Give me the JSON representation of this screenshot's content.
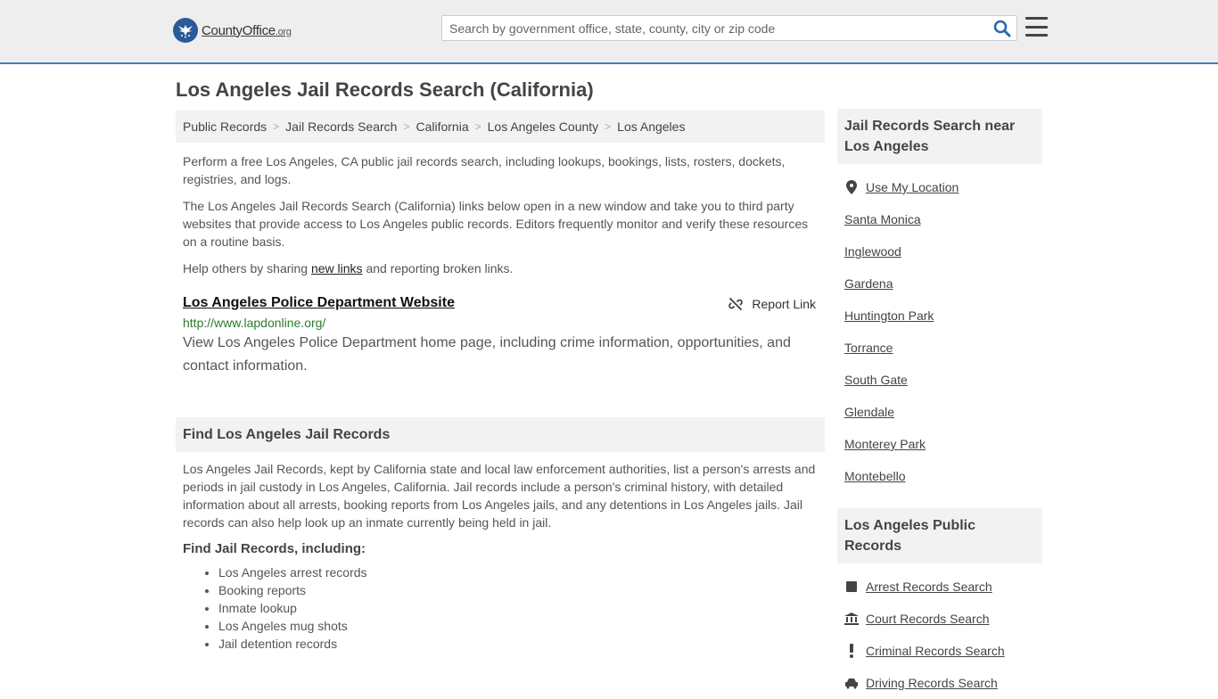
{
  "header": {
    "logo_text": "CountyOffice",
    "logo_tld": ".org",
    "search_placeholder": "Search by government office, state, county, city or zip code"
  },
  "page_title": "Los Angeles Jail Records Search (California)",
  "breadcrumb": [
    "Public Records",
    "Jail Records Search",
    "California",
    "Los Angeles County",
    "Los Angeles"
  ],
  "intro": {
    "p1": "Perform a free Los Angeles, CA public jail records search, including lookups, bookings, lists, rosters, dockets, registries, and logs.",
    "p2": "The Los Angeles Jail Records Search (California) links below open in a new window and take you to third party websites that provide access to Los Angeles public records. Editors frequently monitor and verify these resources on a routine basis.",
    "p3_pre": "Help others by sharing ",
    "p3_link": "new links",
    "p3_post": " and reporting broken links."
  },
  "result": {
    "title": "Los Angeles Police Department Website",
    "report_label": "Report Link",
    "url": "http://www.lapdonline.org/",
    "description": "View Los Angeles Police Department home page, including crime information, opportunities, and contact information."
  },
  "find_section": {
    "heading": "Find Los Angeles Jail Records",
    "body": "Los Angeles Jail Records, kept by California state and local law enforcement authorities, list a person's arrests and periods in jail custody in Los Angeles, California. Jail records include a person's criminal history, with detailed information about all arrests, booking reports from Los Angeles jails, and any detentions in Los Angeles jails. Jail records can also help look up an inmate currently being held in jail.",
    "subheading": "Find Jail Records, including:",
    "items": [
      "Los Angeles arrest records",
      "Booking reports",
      "Inmate lookup",
      "Los Angeles mug shots",
      "Jail detention records"
    ]
  },
  "sidebar": {
    "nearby_heading": "Jail Records Search near Los Angeles",
    "use_location": "Use My Location",
    "nearby": [
      "Santa Monica",
      "Inglewood",
      "Gardena",
      "Huntington Park",
      "Torrance",
      "South Gate",
      "Glendale",
      "Monterey Park",
      "Montebello"
    ],
    "public_heading": "Los Angeles Public Records",
    "public_links": [
      {
        "label": "Arrest Records Search",
        "icon": "square-icon"
      },
      {
        "label": "Court Records Search",
        "icon": "courthouse-icon"
      },
      {
        "label": "Criminal Records Search",
        "icon": "exclamation-icon"
      },
      {
        "label": "Driving Records Search",
        "icon": "car-icon"
      }
    ]
  }
}
